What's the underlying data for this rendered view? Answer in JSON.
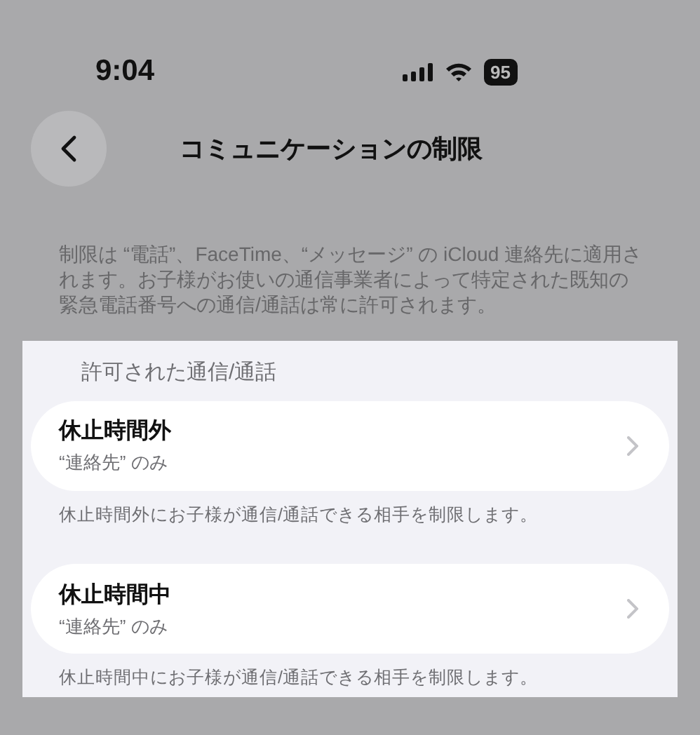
{
  "status_bar": {
    "time": "9:04",
    "battery": "95"
  },
  "nav": {
    "title": "コミュニケーションの制限"
  },
  "description": "制限は “電話”、FaceTime、“メッセージ” の iCloud 連絡先に適用されます。お子様がお使いの通信事業者によって特定された既知の緊急電話番号への通信/通話は常に許可されます。",
  "section": {
    "header": "許可された通信/通話",
    "rows": [
      {
        "title": "休止時間外",
        "subtitle": "“連絡先” のみ",
        "footer": "休止時間外にお子様が通信/通話できる相手を制限します。"
      },
      {
        "title": "休止時間中",
        "subtitle": "“連絡先” のみ",
        "footer": "休止時間中にお子様が通信/通話できる相手を制限します。"
      }
    ]
  }
}
